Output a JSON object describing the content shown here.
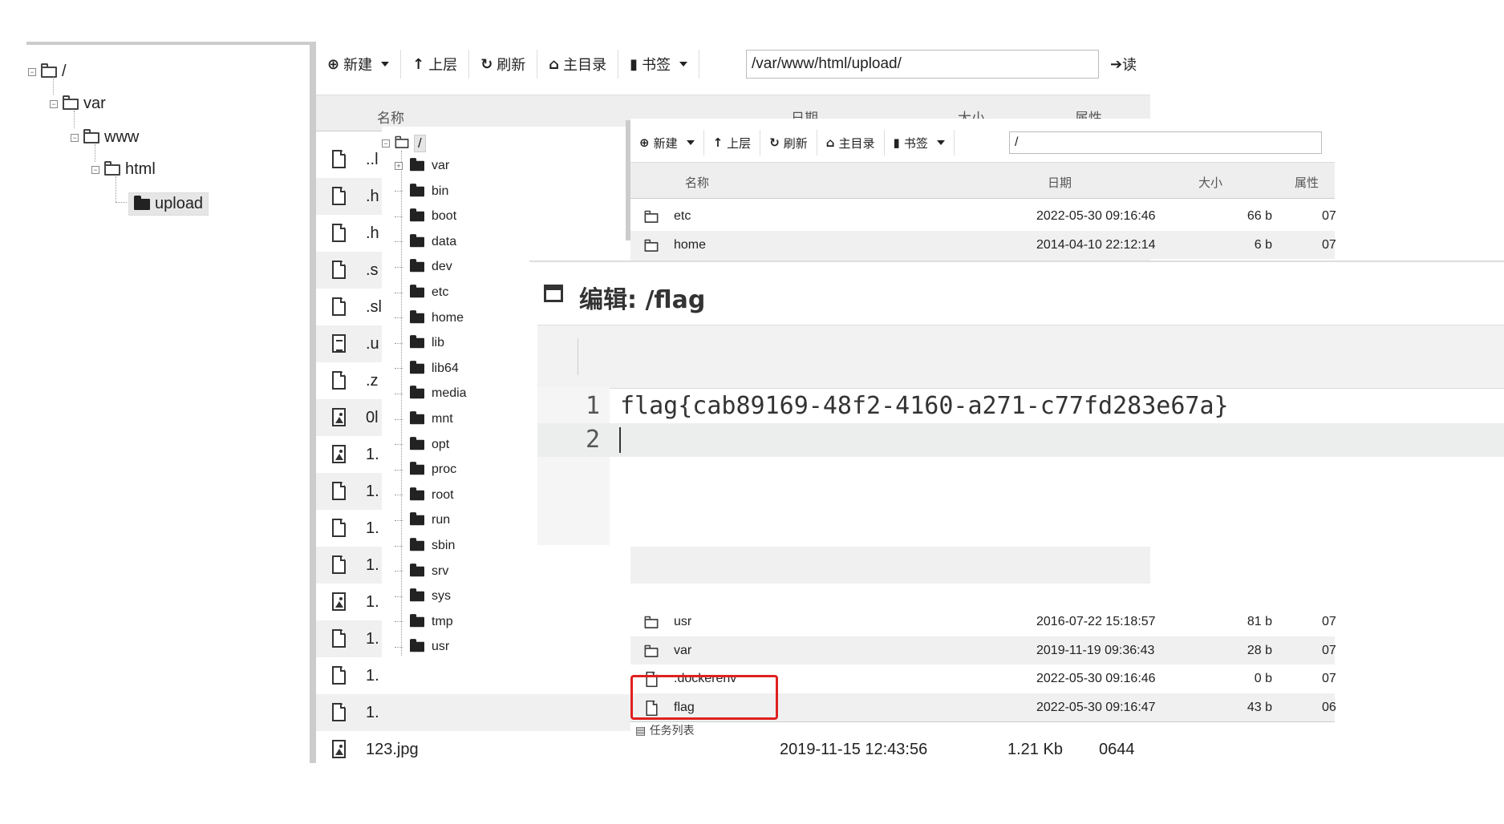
{
  "left_tree": {
    "nodes": [
      {
        "label": "/"
      },
      {
        "label": "var"
      },
      {
        "label": "www"
      },
      {
        "label": "html"
      },
      {
        "label": "upload"
      }
    ]
  },
  "back_panel": {
    "toolbar": {
      "new": "新建",
      "up": "上层",
      "refresh": "刷新",
      "home": "主目录",
      "bookmark": "书签",
      "path": "/var/www/html/upload/",
      "go": "读"
    },
    "headers": {
      "name": "名称",
      "date": "日期",
      "size": "大小",
      "attr": "属性"
    },
    "rows": [
      {
        "icon": "file-icon",
        "name": "..l"
      },
      {
        "icon": "file-icon",
        "name": ".h"
      },
      {
        "icon": "file-icon",
        "name": ".h"
      },
      {
        "icon": "file-icon",
        "name": ".s"
      },
      {
        "icon": "file-icon",
        "name": ".sl"
      },
      {
        "icon": "text-file-icon",
        "name": ".u"
      },
      {
        "icon": "file-icon",
        "name": ".z"
      },
      {
        "icon": "image-file-icon",
        "name": "0l"
      },
      {
        "icon": "image-file-icon",
        "name": "1."
      },
      {
        "icon": "file-icon",
        "name": "1."
      },
      {
        "icon": "file-icon",
        "name": "1."
      },
      {
        "icon": "file-icon",
        "name": "1."
      },
      {
        "icon": "image-file-icon",
        "name": "1."
      },
      {
        "icon": "file-icon",
        "name": "1."
      },
      {
        "icon": "file-icon",
        "name": "1."
      },
      {
        "icon": "file-icon",
        "name": "1."
      },
      {
        "icon": "image-file-icon",
        "name": "123.jpg",
        "date": "2019-11-15 12:43:56",
        "size": "1.21 Kb",
        "attr": "0644"
      }
    ]
  },
  "mid_tree": {
    "root": "/",
    "items": [
      "var",
      "bin",
      "boot",
      "data",
      "dev",
      "etc",
      "home",
      "lib",
      "lib64",
      "media",
      "mnt",
      "opt",
      "proc",
      "root",
      "run",
      "sbin",
      "srv",
      "sys",
      "tmp",
      "usr"
    ]
  },
  "front_panel": {
    "toolbar": {
      "new": "新建",
      "up": "上层",
      "refresh": "刷新",
      "home": "主目录",
      "bookmark": "书签",
      "path": "/"
    },
    "headers": {
      "name": "名称",
      "date": "日期",
      "size": "大小",
      "attr": "属性"
    },
    "top_rows": [
      {
        "icon": "folder-icon",
        "name": "etc",
        "date": "2022-05-30 09:16:46",
        "size": "66 b",
        "attr": "07"
      },
      {
        "icon": "folder-icon",
        "name": "home",
        "date": "2014-04-10 22:12:14",
        "size": "6 b",
        "attr": "07"
      }
    ],
    "bottom_rows": [
      {
        "icon": "folder-icon",
        "name": "usr",
        "date": "2016-07-22 15:18:57",
        "size": "81 b",
        "attr": "07"
      },
      {
        "icon": "folder-icon",
        "name": "var",
        "date": "2019-11-19 09:36:43",
        "size": "28 b",
        "attr": "07"
      },
      {
        "icon": "file-icon",
        "name": ".dockerenv",
        "date": "2022-05-30 09:16:46",
        "size": "0 b",
        "attr": "07"
      },
      {
        "icon": "file-icon",
        "name": "flag",
        "date": "2022-05-30 09:16:47",
        "size": "43 b",
        "attr": "06"
      }
    ],
    "task_list": "任务列表"
  },
  "editor": {
    "title": "编辑: /flag",
    "lines": [
      {
        "num": "1",
        "text": "flag{cab89169-48f2-4160-a271-c77fd283e67a}"
      },
      {
        "num": "2",
        "text": ""
      }
    ]
  },
  "colors": {
    "highlight": "#e02020",
    "row_alt": "#f0f0f0",
    "header_bg": "#eeeeee"
  }
}
